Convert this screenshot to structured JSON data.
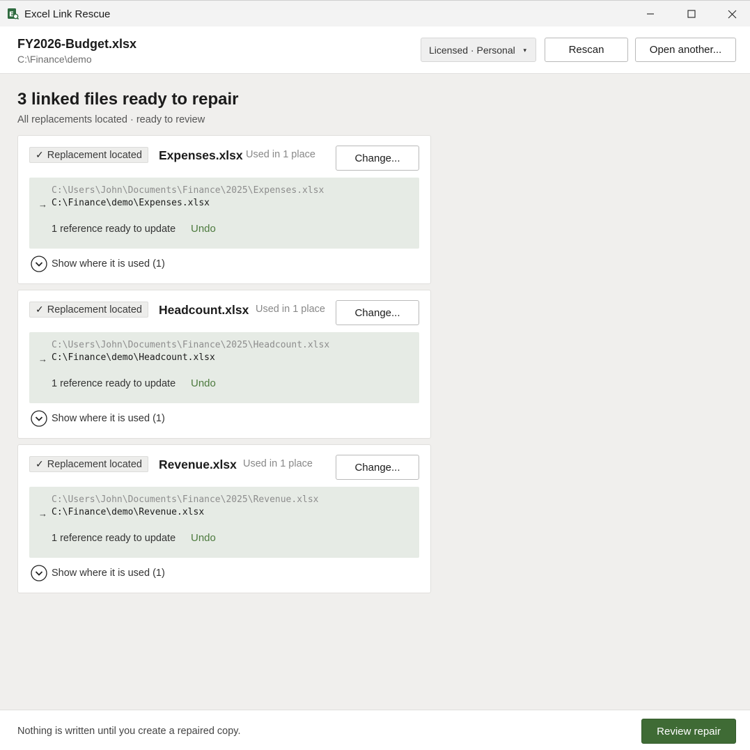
{
  "window": {
    "title": "Excel Link Rescue",
    "icon": "excel-app-icon",
    "controls": [
      "minimize-icon",
      "maximize-icon",
      "close-icon"
    ]
  },
  "header": {
    "file_name": "FY2026-Budget.xlsx",
    "file_path": "C:\\Finance\\demo",
    "license_label": "Licensed · Personal",
    "license_caret": "▾",
    "rescan_label": "Rescan",
    "open_label": "Open another..."
  },
  "main": {
    "title": "3 linked files ready to repair",
    "subtitle": "All replacements located · ready to review"
  },
  "cards": [
    {
      "status": "Replacement located",
      "check": "✓",
      "file": "Expenses.xlsx",
      "used": "Used in 1 place",
      "change_label": "Change...",
      "old_path": "C:\\Users\\John\\Documents\\Finance\\2025\\Expenses.xlsx",
      "arrow": "→",
      "new_path": "C:\\Finance\\demo\\Expenses.xlsx",
      "ref_text": "1 reference ready to update",
      "undo_label": "Undo",
      "expander_label": "Show where it is used (1)"
    },
    {
      "status": "Replacement located",
      "check": "✓",
      "file": "Headcount.xlsx",
      "used": "Used in 1 place",
      "change_label": "Change...",
      "old_path": "C:\\Users\\John\\Documents\\Finance\\2025\\Headcount.xlsx",
      "arrow": "→",
      "new_path": "C:\\Finance\\demo\\Headcount.xlsx",
      "ref_text": "1 reference ready to update",
      "undo_label": "Undo",
      "expander_label": "Show where it is used (1)"
    },
    {
      "status": "Replacement located",
      "check": "✓",
      "file": "Revenue.xlsx",
      "used": "Used in 1 place",
      "change_label": "Change...",
      "old_path": "C:\\Users\\John\\Documents\\Finance\\2025\\Revenue.xlsx",
      "arrow": "→",
      "new_path": "C:\\Finance\\demo\\Revenue.xlsx",
      "ref_text": "1 reference ready to update",
      "undo_label": "Undo",
      "expander_label": "Show where it is used (1)"
    }
  ],
  "footer": {
    "note": "Nothing is written until you create a repaired copy.",
    "review_label": "Review repair"
  },
  "colors": {
    "accent": "#3f6b35",
    "link": "#4d7a3e",
    "path_box": "#e6ebe5"
  }
}
